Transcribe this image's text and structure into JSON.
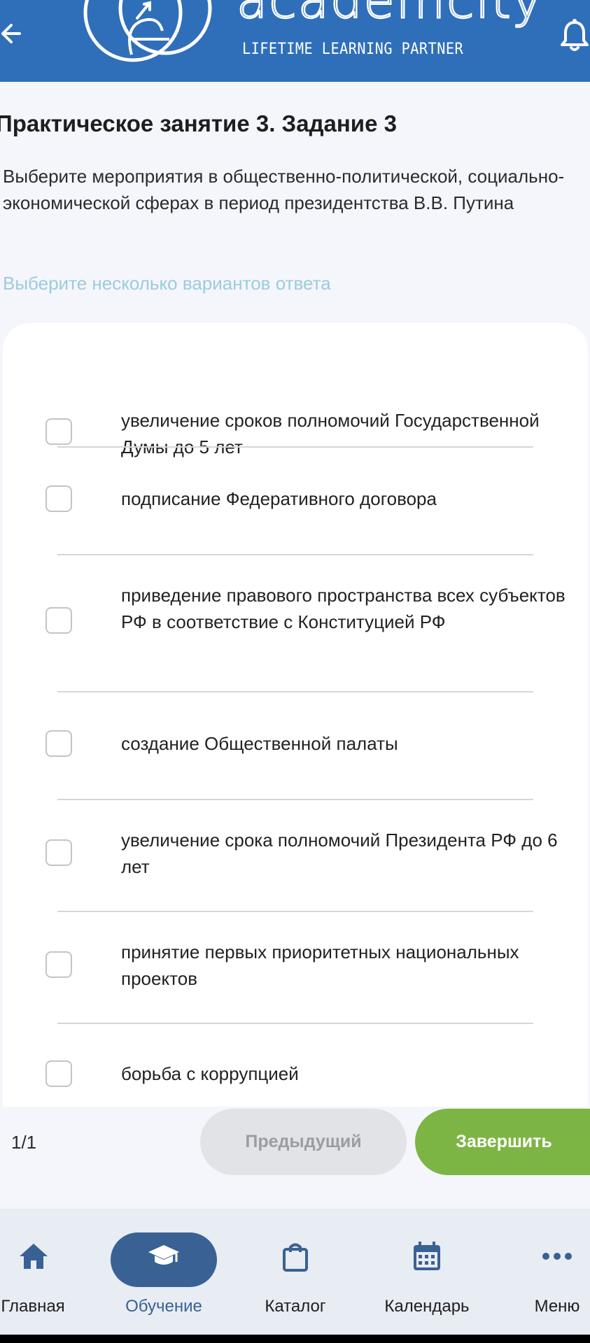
{
  "header": {
    "logo_word": "academcity",
    "logo_tagline": "LIFETIME LEARNING PARTNER",
    "back_icon": "arrow-left-icon",
    "bell_icon": "bell-icon",
    "background_color": "#2f6fba"
  },
  "lesson": {
    "title": "Практическое занятие 3. Задание 3",
    "question": "Выберите мероприятия в общественно-политической, социально-экономической сферах в период президентства В.В. Путина",
    "hint": "Выберите несколько вариантов ответа"
  },
  "options": [
    {
      "label": "увеличение сроков полномочий Государственной Думы до 5 лет",
      "checked": false
    },
    {
      "label": "подписание Федеративного договора",
      "checked": false
    },
    {
      "label": "приведение правового пространства всех субъектов РФ в соответствие с Конституцией РФ",
      "checked": false
    },
    {
      "label": "создание Общественной палаты",
      "checked": false
    },
    {
      "label": "увеличение срока полномочий Президента РФ до 6 лет",
      "checked": false
    },
    {
      "label": "принятие первых приоритетных национальных проектов",
      "checked": false
    },
    {
      "label": "борьба с коррупцией",
      "checked": false
    }
  ],
  "pager": {
    "counter": "1/1",
    "prev_label": "Предыдущий",
    "finish_label": "Завершить",
    "finish_color": "#7db544"
  },
  "nav": {
    "active": "Обучение",
    "accent_color": "#3a6194",
    "items": [
      {
        "label": "Главная",
        "icon": "home-icon"
      },
      {
        "label": "Обучение",
        "icon": "graduation-cap-icon"
      },
      {
        "label": "Каталог",
        "icon": "shopping-bag-icon"
      },
      {
        "label": "Календарь",
        "icon": "calendar-icon"
      },
      {
        "label": "Меню",
        "icon": "more-dots-icon"
      }
    ]
  }
}
